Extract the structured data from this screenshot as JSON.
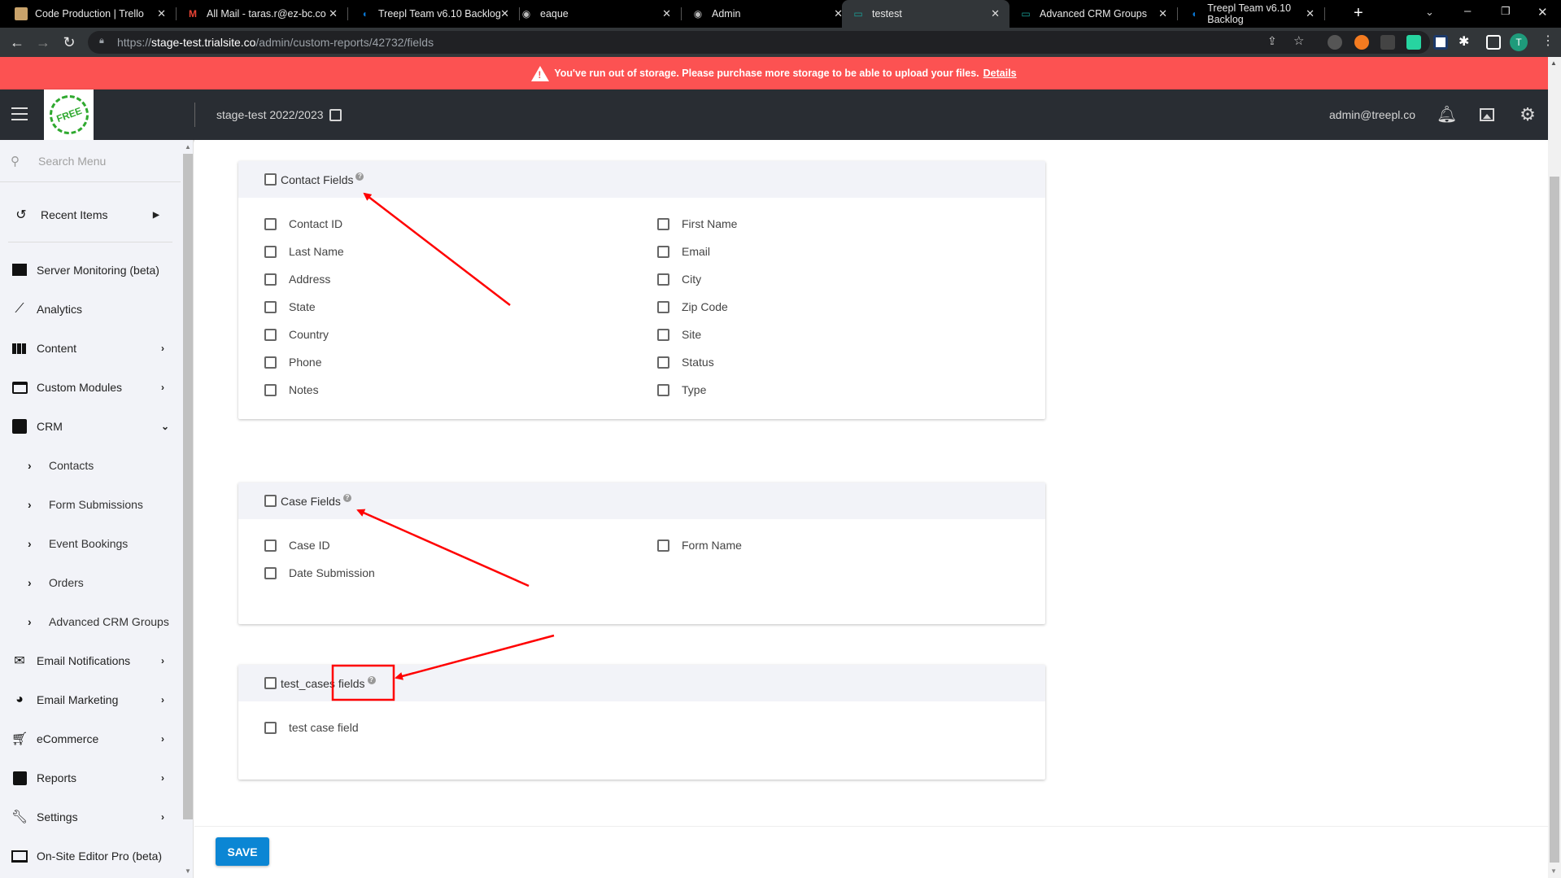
{
  "browser": {
    "tabs": [
      {
        "title": "Code Production | Trello",
        "icon": "trello-icon",
        "active": false
      },
      {
        "title": "All Mail - taras.r@ez-bc.co",
        "icon": "gmail-icon",
        "active": false
      },
      {
        "title": "Treepl Team v6.10 Backlog",
        "icon": "azure-devops-icon",
        "active": false
      },
      {
        "title": "eaque",
        "icon": "globe-icon",
        "active": false
      },
      {
        "title": "Admin",
        "icon": "globe-icon",
        "active": false
      },
      {
        "title": "testest",
        "icon": "monitor-icon",
        "active": true
      },
      {
        "title": "Advanced CRM Groups",
        "icon": "monitor-icon",
        "active": false
      },
      {
        "title": "Treepl Team v6.10 Backlog",
        "icon": "azure-devops-icon",
        "active": false
      }
    ],
    "url_scheme": "https://",
    "url_host": "stage-test.trialsite.co",
    "url_path": "/admin/custom-reports/42732/fields",
    "profile_initial": "T"
  },
  "banner": {
    "message": "You've run out of storage. Please purchase more storage to be able to upload your files.",
    "link": "Details",
    "color": "#fc5252"
  },
  "header": {
    "logo_text": "FREE",
    "site_name": "stage-test 2022/2023",
    "user_email": "admin@treepl.co"
  },
  "sidebar": {
    "search_placeholder": "Search Menu",
    "recent": "Recent Items",
    "items": [
      {
        "label": "Server Monitoring (beta)",
        "icon": "server-icon",
        "has_chevron": false
      },
      {
        "label": "Analytics",
        "icon": "trending-up-icon",
        "has_chevron": false
      },
      {
        "label": "Content",
        "icon": "columns-icon",
        "has_chevron": true
      },
      {
        "label": "Custom Modules",
        "icon": "modules-icon",
        "has_chevron": true
      },
      {
        "label": "CRM",
        "icon": "contact-icon",
        "has_chevron": true,
        "expanded": true
      },
      {
        "label": "Email Notifications",
        "icon": "mail-icon",
        "has_chevron": true
      },
      {
        "label": "Email Marketing",
        "icon": "pie-icon",
        "has_chevron": true
      },
      {
        "label": "eCommerce",
        "icon": "cart-icon",
        "has_chevron": true
      },
      {
        "label": "Reports",
        "icon": "report-icon",
        "has_chevron": true
      },
      {
        "label": "Settings",
        "icon": "wrench-icon",
        "has_chevron": true
      },
      {
        "label": "On-Site Editor Pro (beta)",
        "icon": "editor-icon",
        "has_chevron": false
      }
    ],
    "crm_subitems": [
      "Contacts",
      "Form Submissions",
      "Event Bookings",
      "Orders",
      "Advanced CRM Groups"
    ]
  },
  "sections": [
    {
      "title": "Contact Fields",
      "left": [
        "Contact ID",
        "Last Name",
        "Address",
        "State",
        "Country",
        "Phone",
        "Notes"
      ],
      "right": [
        "First Name",
        "Email",
        "City",
        "Zip Code",
        "Site",
        "Status",
        "Type"
      ]
    },
    {
      "title": "Case Fields",
      "left": [
        "Case ID",
        "Date Submission"
      ],
      "right": [
        "Form Name"
      ]
    },
    {
      "title": "test_cases fields",
      "left": [
        "test case field"
      ],
      "right": []
    }
  ],
  "footer": {
    "save_label": "SAVE"
  },
  "colors": {
    "accent": "#0b86d4",
    "annotation": "#ff0000"
  }
}
